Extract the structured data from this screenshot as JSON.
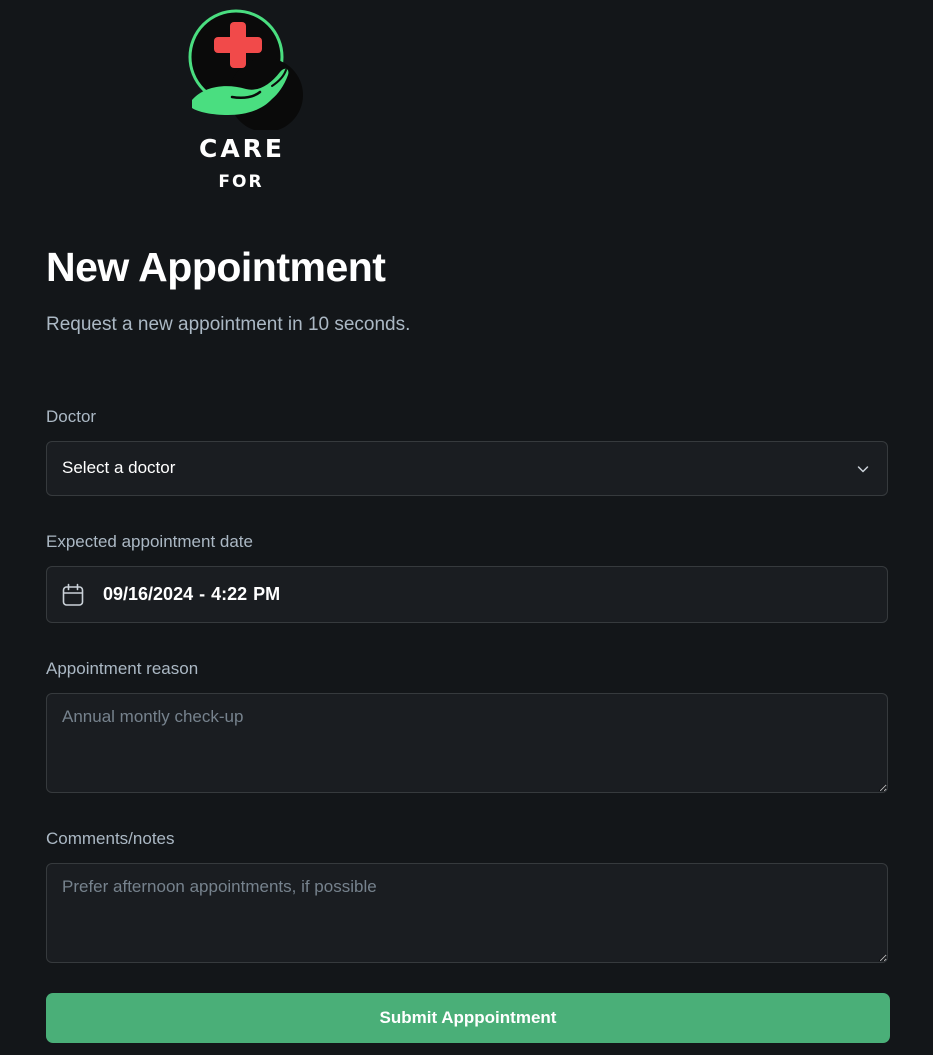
{
  "brand": {
    "line1": "CARE",
    "line2": "FOR",
    "colors": {
      "ring": "#4ade80",
      "cross": "#f14a4a",
      "hand": "#4ade80"
    }
  },
  "header": {
    "title": "New Appointment",
    "subtitle": "Request a new appointment in 10 seconds."
  },
  "form": {
    "doctor": {
      "label": "Doctor",
      "value": "Select a doctor"
    },
    "date": {
      "label": "Expected appointment date",
      "value": "09/16/2024 - 4:22 PM"
    },
    "reason": {
      "label": "Appointment reason",
      "placeholder": "Annual montly check-up"
    },
    "notes": {
      "label": "Comments/notes",
      "placeholder": "Prefer afternoon appointments, if possible"
    },
    "submit_label": "Submit Apppointment"
  },
  "icons": {
    "doctor_select": "chevron-down-icon",
    "date_field": "calendar-icon"
  },
  "theme": {
    "background": "#131619",
    "input_background": "#1a1d21",
    "input_border": "#363a3d",
    "label_color": "#abb8c4",
    "placeholder_color": "#76828d",
    "accent": "#4aaf78"
  }
}
